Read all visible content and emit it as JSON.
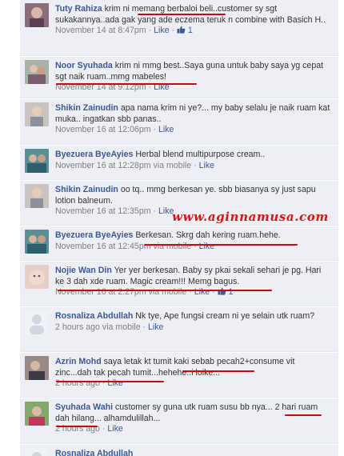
{
  "comments": [
    {
      "author": "Tuty Rahiza",
      "text": "krim ni memang berbaloi beli..customer sy sgt sukakannya..ada gak yang ade eczema teruk n combine with Basich H..",
      "time": "November 14 at 8:47pm",
      "like_label": "Like",
      "like_count": "1"
    },
    {
      "author": "Noor Syuhada",
      "text": "krim ni mmg best..Saya guna untuk baby saya yg cepat sgt naik ruam..mmg mabeles!",
      "time": "November 14 at 9:12pm",
      "like_label": "Like"
    },
    {
      "author": "Shikin Zainudin",
      "text": "apa nama krim ni ye?... my baby selalu je naik ruam kat muka.. ingatkan sbb panas..",
      "time": "November 16 at 12:06pm",
      "like_label": "Like"
    },
    {
      "author": "Byezuera ByeAyies",
      "text": "Herbal blend multipurpose cream..",
      "time": "November 16 at 12:28pm via mobile",
      "like_label": "Like"
    },
    {
      "author": "Shikin Zainudin",
      "text": "oo tq.. mmg berkesan ye. sbb biasanya sy just sapu lotion balneum.",
      "time": "November 16 at 12:35pm",
      "like_label": "Like"
    },
    {
      "author": "Byezuera ByeAyies",
      "text": "Berkesan. Skrg dah kering ruam.hehe.",
      "time": "November 16 at 12:45pm via mobile",
      "like_label": "Like"
    },
    {
      "author": "Nojie Wan Din",
      "text": "Yer yer berkesan. Baby sy pkai sekali sehari je pg. Hari ke 3 dah xde ruam. Magic cream!!! Memg bagus.",
      "time": "November 16 at 2:27pm via mobile",
      "like_label": "Like",
      "like_count": "1"
    },
    {
      "author": "Rosnaliza Abdullah",
      "text": "Nk tye, Ape fungsi cream ni ye selain utk ruam?",
      "time": "2 hours ago via mobile",
      "like_label": "Like"
    },
    {
      "author": "Azrin Mohd",
      "text": "saya letak kt tumit kaki sebab pecah2+consume vit zinc...dah tak pecah tumit...hehehe..i loike...",
      "time": "2 hours ago",
      "like_label": "Like"
    },
    {
      "author": "Syuhada Wahi",
      "text": "customer sy guna utk ruam susu bb nya... 2 hari ruam dah hilang... alhamdulillah...",
      "time": "2 hours ago",
      "like_label": "Like"
    },
    {
      "author": "Rosnaliza Abdullah"
    }
  ],
  "separator": " · ",
  "watermark": "www.aginnamusa.com",
  "colors": {
    "link": "#3b5998",
    "comment_bg": "#edeff4",
    "timestamp": "#808080",
    "highlight": "#cc0a0a",
    "watermark": "#d81414"
  },
  "icons": {
    "like_count_icon": "thumbs-up-icon"
  }
}
